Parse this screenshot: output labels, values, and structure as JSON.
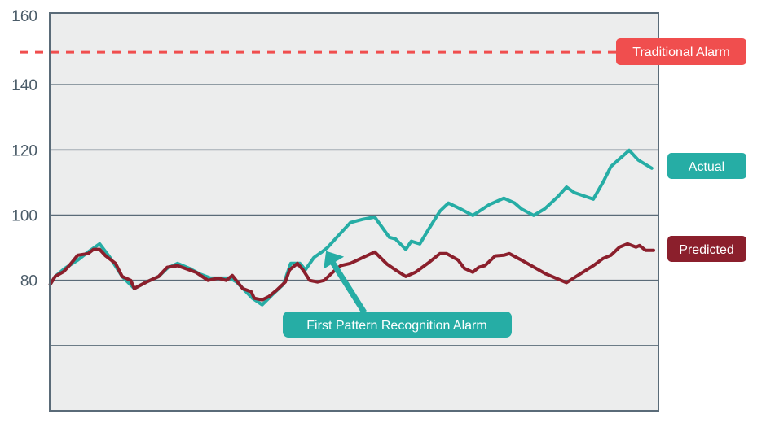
{
  "chart_data": {
    "type": "line",
    "title": "",
    "xlabel": "",
    "ylabel": "",
    "xlim": [
      0,
      100
    ],
    "ylim": [
      40,
      162
    ],
    "y_ticks": [
      160,
      140,
      120,
      100,
      80
    ],
    "y_gridlines": [
      140,
      120,
      100,
      80,
      60
    ],
    "grid": true,
    "x_axis_labels": false,
    "threshold": {
      "name": "Traditional Alarm",
      "value": 150,
      "color": "#f04e4e",
      "style": "dashed"
    },
    "annotation": {
      "text": "First Pattern Recognition Alarm",
      "points_to": [
        45.4,
        89
      ],
      "color": "#26ada5"
    },
    "series": [
      {
        "name": "Actual",
        "color": "#26ada5",
        "points": [
          [
            0.1,
            78.8
          ],
          [
            0.9,
            81.2
          ],
          [
            2.5,
            83.7
          ],
          [
            4.6,
            86.2
          ],
          [
            6.3,
            88.7
          ],
          [
            8.2,
            91.2
          ],
          [
            9.9,
            87.0
          ],
          [
            11.9,
            81.2
          ],
          [
            13.9,
            77.5
          ],
          [
            15.9,
            79.5
          ],
          [
            17.9,
            81.2
          ],
          [
            19.3,
            83.7
          ],
          [
            21.0,
            85.2
          ],
          [
            22.9,
            83.7
          ],
          [
            24.6,
            82.0
          ],
          [
            26.4,
            80.7
          ],
          [
            28.0,
            80.7
          ],
          [
            29.6,
            80.7
          ],
          [
            30.7,
            79.5
          ],
          [
            32.0,
            77.0
          ],
          [
            33.3,
            74.5
          ],
          [
            34.9,
            72.5
          ],
          [
            36.7,
            75.8
          ],
          [
            38.4,
            78.8
          ],
          [
            39.6,
            85.2
          ],
          [
            41.1,
            85.2
          ],
          [
            42.0,
            83.2
          ],
          [
            43.4,
            87.0
          ],
          [
            44.7,
            88.7
          ],
          [
            45.6,
            90.0
          ],
          [
            47.4,
            93.7
          ],
          [
            49.4,
            97.7
          ],
          [
            51.4,
            98.7
          ],
          [
            53.4,
            99.4
          ],
          [
            55.8,
            93.2
          ],
          [
            56.8,
            92.7
          ],
          [
            58.5,
            89.5
          ],
          [
            59.4,
            92.0
          ],
          [
            60.8,
            91.2
          ],
          [
            62.1,
            95.2
          ],
          [
            64.1,
            101.2
          ],
          [
            65.5,
            103.7
          ],
          [
            67.5,
            101.9
          ],
          [
            69.5,
            99.9
          ],
          [
            72.2,
            103.2
          ],
          [
            74.6,
            105.2
          ],
          [
            76.4,
            103.7
          ],
          [
            77.5,
            101.9
          ],
          [
            79.5,
            99.9
          ],
          [
            81.3,
            101.9
          ],
          [
            83.5,
            105.7
          ],
          [
            84.9,
            108.6
          ],
          [
            86.2,
            106.9
          ],
          [
            89.3,
            104.9
          ],
          [
            90.9,
            110.1
          ],
          [
            92.2,
            114.9
          ],
          [
            95.2,
            119.9
          ],
          [
            96.7,
            116.9
          ],
          [
            98.9,
            114.4
          ]
        ]
      },
      {
        "name": "Predicted",
        "color": "#8b1f2c",
        "points": [
          [
            0.1,
            78.8
          ],
          [
            0.9,
            81.2
          ],
          [
            2.3,
            82.7
          ],
          [
            3.2,
            84.5
          ],
          [
            4.6,
            87.7
          ],
          [
            6.3,
            88.2
          ],
          [
            7.2,
            89.5
          ],
          [
            8.2,
            89.5
          ],
          [
            9.2,
            87.5
          ],
          [
            10.8,
            85.2
          ],
          [
            11.9,
            81.2
          ],
          [
            13.3,
            80.0
          ],
          [
            13.9,
            77.5
          ],
          [
            15.9,
            79.5
          ],
          [
            17.9,
            81.2
          ],
          [
            19.3,
            84.0
          ],
          [
            21.0,
            84.5
          ],
          [
            22.9,
            83.2
          ],
          [
            24.0,
            82.5
          ],
          [
            26.0,
            80.0
          ],
          [
            27.7,
            80.7
          ],
          [
            29.0,
            80.0
          ],
          [
            30.0,
            81.5
          ],
          [
            31.7,
            77.5
          ],
          [
            33.1,
            76.5
          ],
          [
            33.6,
            74.5
          ],
          [
            34.9,
            74.0
          ],
          [
            36.0,
            75.0
          ],
          [
            37.3,
            77.0
          ],
          [
            38.7,
            79.5
          ],
          [
            39.4,
            83.2
          ],
          [
            40.7,
            85.2
          ],
          [
            41.6,
            83.2
          ],
          [
            42.7,
            80.0
          ],
          [
            44.0,
            79.5
          ],
          [
            45.1,
            80.0
          ],
          [
            46.5,
            82.5
          ],
          [
            47.8,
            84.5
          ],
          [
            49.4,
            85.2
          ],
          [
            53.4,
            88.7
          ],
          [
            55.4,
            85.0
          ],
          [
            56.8,
            83.2
          ],
          [
            58.5,
            81.2
          ],
          [
            60.1,
            82.5
          ],
          [
            62.1,
            85.2
          ],
          [
            64.1,
            88.2
          ],
          [
            65.2,
            88.2
          ],
          [
            67.1,
            86.2
          ],
          [
            68.1,
            83.7
          ],
          [
            69.5,
            82.5
          ],
          [
            70.5,
            84.0
          ],
          [
            71.5,
            84.5
          ],
          [
            73.2,
            87.5
          ],
          [
            74.6,
            87.7
          ],
          [
            75.5,
            88.2
          ],
          [
            77.5,
            86.2
          ],
          [
            81.5,
            82.0
          ],
          [
            84.9,
            79.3
          ],
          [
            86.9,
            81.7
          ],
          [
            89.3,
            84.5
          ],
          [
            90.9,
            86.7
          ],
          [
            92.2,
            87.7
          ],
          [
            93.6,
            90.2
          ],
          [
            94.9,
            91.2
          ],
          [
            96.3,
            90.2
          ],
          [
            96.9,
            90.7
          ],
          [
            97.9,
            89.2
          ],
          [
            99.2,
            89.2
          ]
        ]
      }
    ]
  },
  "colors": {
    "plot_background": "#eceded",
    "axis": "#5a6b78",
    "tick_text": "#4a5b68"
  }
}
